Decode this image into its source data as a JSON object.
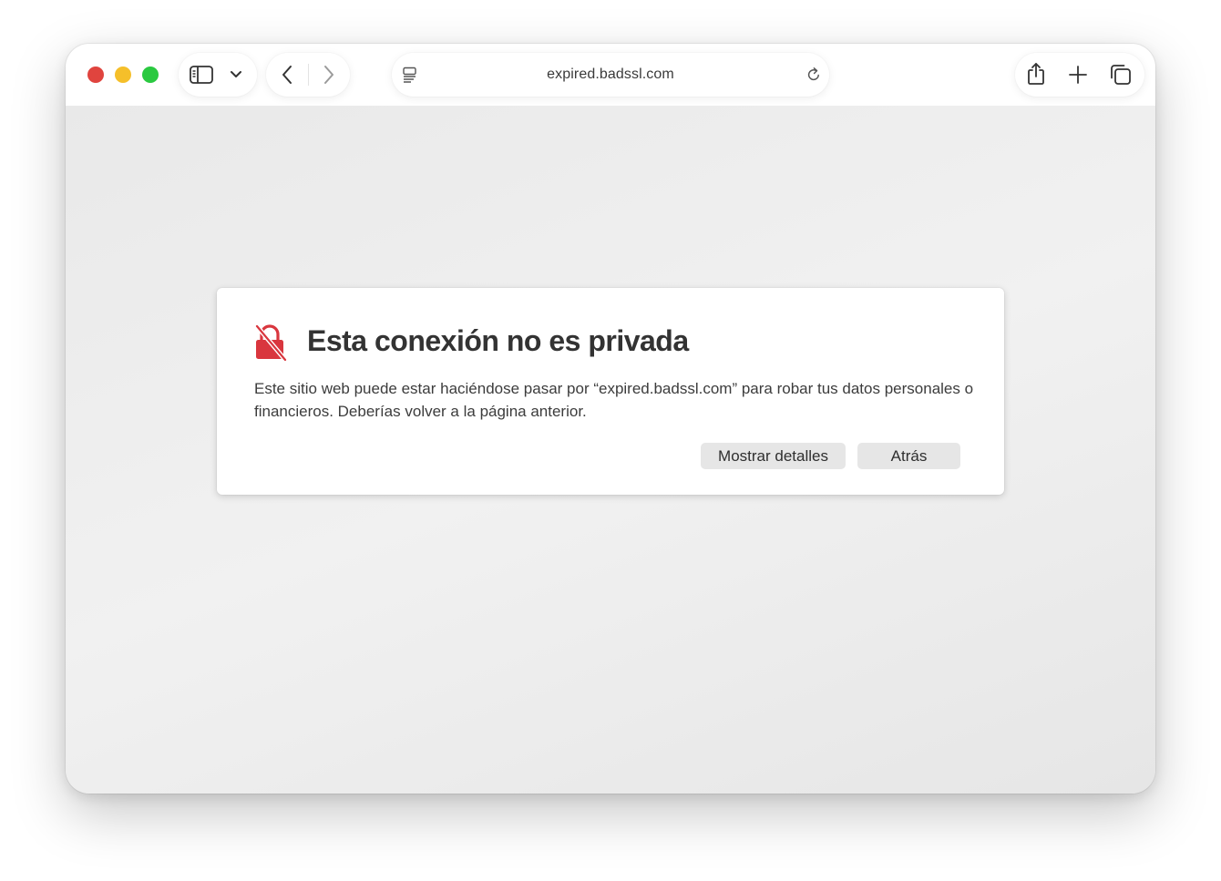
{
  "window": {
    "colors": {
      "close": "#e0443e",
      "minimize": "#f5bf2a",
      "zoom": "#2ac940"
    }
  },
  "toolbar": {
    "address_bar": {
      "url": "expired.badssl.com"
    },
    "icons": {
      "sidebar": "sidebar-icon",
      "chevron": "chevron-down-icon",
      "back": "chevron-left-icon",
      "forward": "chevron-right-icon",
      "page_menu": "page-menu-icon",
      "reload": "reload-icon",
      "share": "share-icon",
      "new_tab": "plus-icon",
      "tabs": "tabs-overview-icon"
    }
  },
  "warning": {
    "title": "Esta conexión no es privada",
    "body": "Este sitio web puede estar haciéndose pasar por “expired.badssl.com” para robar tus datos personales o financieros. Deberías volver a la página anterior.",
    "icon": "broken-lock-icon",
    "accent_color": "#d9363e",
    "buttons": {
      "details": "Mostrar detalles",
      "back": "Atrás"
    }
  }
}
